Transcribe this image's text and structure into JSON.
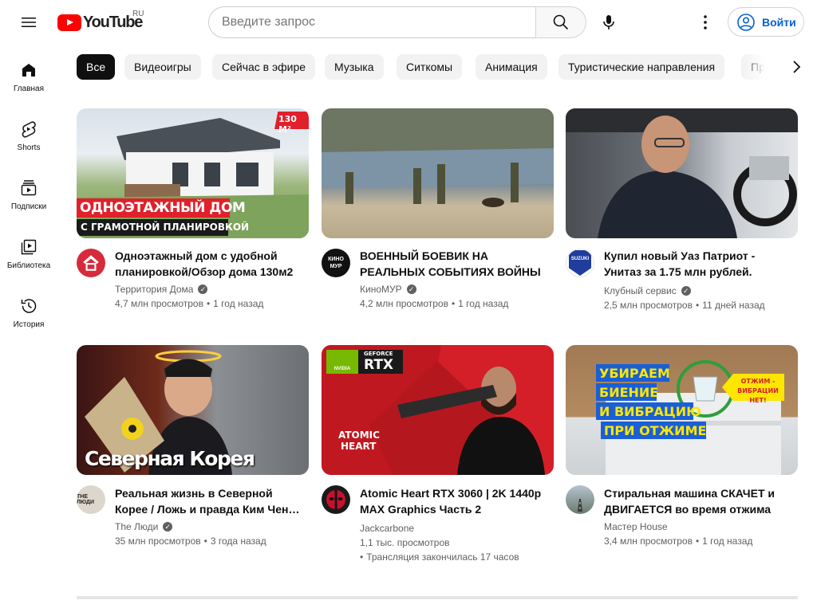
{
  "header": {
    "logo_text": "YouTube",
    "region": "RU",
    "search_placeholder": "Введите запрос",
    "signin_label": "Войти"
  },
  "sidebar": {
    "items": [
      {
        "label": "Главная",
        "icon": "home-icon"
      },
      {
        "label": "Shorts",
        "icon": "shorts-icon"
      },
      {
        "label": "Подписки",
        "icon": "subscriptions-icon"
      },
      {
        "label": "Библиотека",
        "icon": "library-icon"
      },
      {
        "label": "История",
        "icon": "history-icon"
      }
    ]
  },
  "chips": [
    "Все",
    "Видеоигры",
    "Сейчас в эфире",
    "Музыка",
    "Ситкомы",
    "Анимация",
    "Туристические направления",
    "Пр"
  ],
  "videos": [
    {
      "title": "Одноэтажный дом с удобной планировкой/Обзор дома 130м2",
      "channel": "Территория Дома",
      "verified": true,
      "views": "4,7 млн просмотров",
      "age": "1 год назад",
      "thumb_text": [
        "ОДНОЭТАЖНЫЙ ДОМ",
        "С ГРАМОТНОЙ ПЛАНИРОВКОЙ"
      ],
      "thumb_badge": "130 М²"
    },
    {
      "title": "ВОЕННЫЙ БОЕВИК НА РЕАЛЬНЫХ СОБЫТИЯХ ВОЙНЫ",
      "channel": "КиноМУР",
      "verified": true,
      "views": "4,2 млн просмотров",
      "age": "1 год назад",
      "avatar_text": "КИНО МУР"
    },
    {
      "title": "Купил новый Уаз Патриот - Унитаз за 1.75 млн рублей.",
      "channel": "Клубный сервис",
      "verified": true,
      "views": "2,5 млн просмотров",
      "age": "11 дней назад",
      "avatar_text": "SUZUKI"
    },
    {
      "title": "Реальная жизнь в Северной Корее / Ложь и правда Ким Чен Ына",
      "channel": "The Люди",
      "verified": true,
      "views": "35 млн просмотров",
      "age": "3 года назад",
      "thumb_text": [
        "Северная Корея"
      ],
      "avatar_text": "THE ЛЮДИ"
    },
    {
      "title": "Atomic Heart RTX 3060 | 2K 1440p MAX Graphics Часть 2",
      "channel": "Jackcarbone",
      "verified": false,
      "views": "1,1 тыс. просмотров",
      "age": "Трансляция закончилась 17 часов",
      "thumb_text": [
        "ATOMIC",
        "HEART"
      ],
      "thumb_badge": "RTX",
      "thumb_badge_small": "GEFORCE",
      "thumb_badge_brand": "NVIDIA"
    },
    {
      "title": "Стиральная машина СКАЧЕТ и ДВИГАЕТСЯ во время отжима",
      "channel": "Мастер House",
      "verified": false,
      "views": "3,4 млн просмотров",
      "age": "1 год назад",
      "thumb_text": [
        "УБИРАЕМ",
        "БИЕНИЕ",
        "И ВИБРАЦИЮ",
        "ПРИ ОТЖИМЕ"
      ],
      "thumb_badge": "ОТЖИМ - ВИБРАЦИИ НЕТ!"
    }
  ],
  "colors": {
    "brand_red": "#ff0000",
    "link_blue": "#065fd4",
    "text_secondary": "#606060",
    "chip_bg": "#f2f2f2",
    "chip_active_bg": "#0f0f0f"
  }
}
